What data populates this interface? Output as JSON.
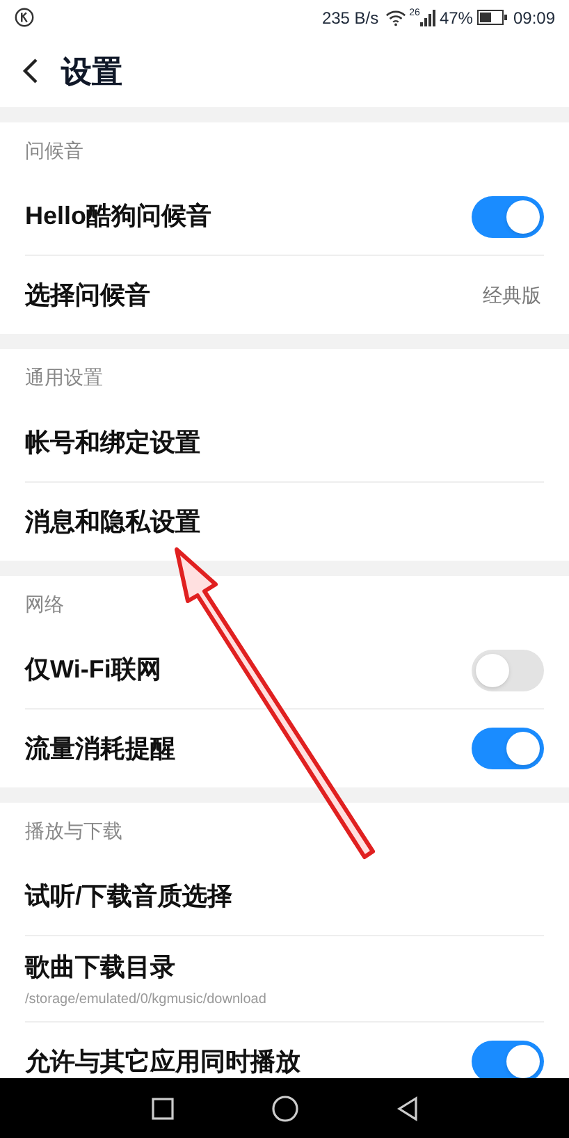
{
  "status_bar": {
    "speed": "235 B/s",
    "network": "26",
    "battery": "47%",
    "time": "09:09"
  },
  "header": {
    "title": "设置"
  },
  "sections": [
    {
      "title": "问候音",
      "items": [
        {
          "kind": "toggle",
          "label": "Hello酷狗问候音",
          "on": true
        },
        {
          "kind": "value",
          "label": "选择问候音",
          "value": "经典版"
        }
      ]
    },
    {
      "title": "通用设置",
      "items": [
        {
          "kind": "link",
          "label": "帐号和绑定设置"
        },
        {
          "kind": "link",
          "label": "消息和隐私设置"
        }
      ]
    },
    {
      "title": "网络",
      "items": [
        {
          "kind": "toggle",
          "label": "仅Wi-Fi联网",
          "on": false
        },
        {
          "kind": "toggle",
          "label": "流量消耗提醒",
          "on": true
        }
      ]
    },
    {
      "title": "播放与下载",
      "items": [
        {
          "kind": "link",
          "label": "试听/下载音质选择"
        },
        {
          "kind": "path",
          "label": "歌曲下载目录",
          "subtitle": "/storage/emulated/0/kgmusic/download"
        },
        {
          "kind": "toggle",
          "label": "允许与其它应用同时播放",
          "on": true
        }
      ]
    }
  ]
}
